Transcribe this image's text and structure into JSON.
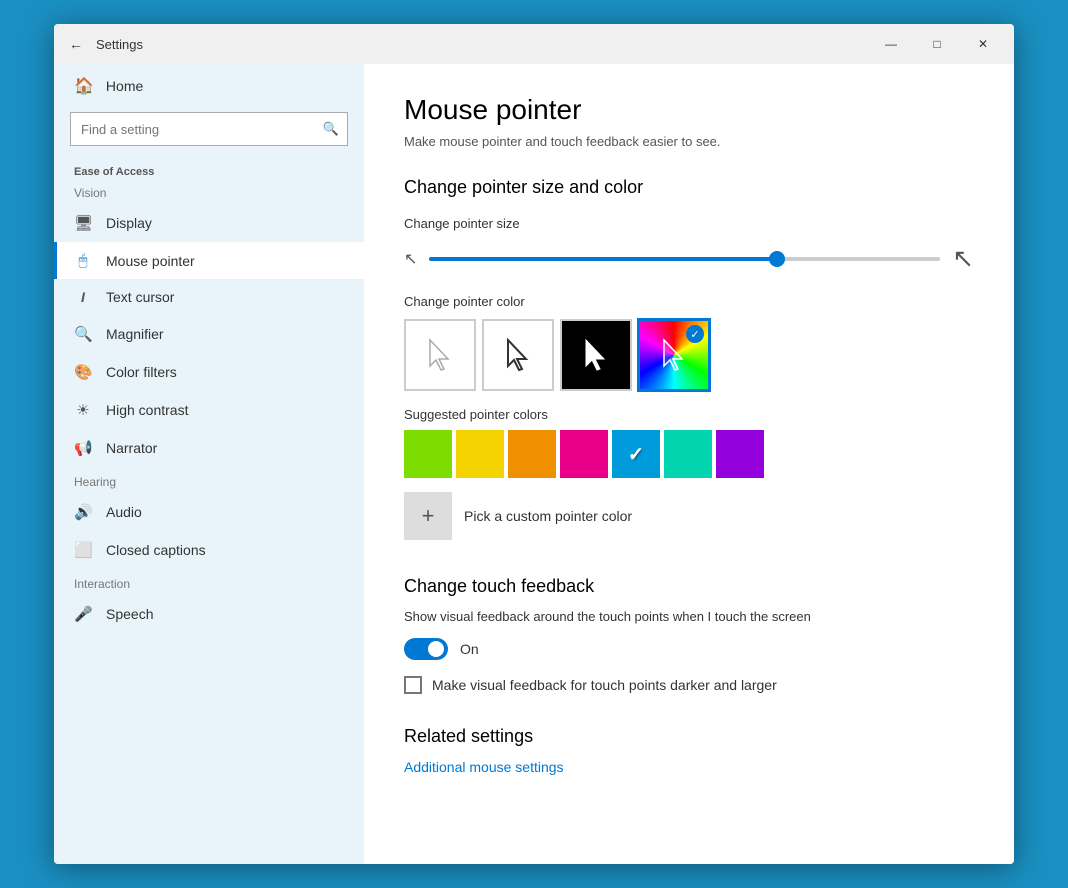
{
  "window": {
    "title": "Settings",
    "back_label": "←",
    "minimize_label": "—",
    "maximize_label": "□",
    "close_label": "✕"
  },
  "sidebar": {
    "home_label": "Home",
    "search_placeholder": "Find a setting",
    "section_vision": "Vision",
    "section_hearing": "Hearing",
    "section_interaction": "Interaction",
    "category_label": "Ease of Access",
    "nav_items_vision": [
      {
        "id": "display",
        "label": "Display",
        "icon": "🖥"
      },
      {
        "id": "mouse-pointer",
        "label": "Mouse pointer",
        "icon": "🖱",
        "active": true
      },
      {
        "id": "text-cursor",
        "label": "Text cursor",
        "icon": "I"
      },
      {
        "id": "magnifier",
        "label": "Magnifier",
        "icon": "🔍"
      },
      {
        "id": "color-filters",
        "label": "Color filters",
        "icon": "🎨"
      },
      {
        "id": "high-contrast",
        "label": "High contrast",
        "icon": "☀"
      },
      {
        "id": "narrator",
        "label": "Narrator",
        "icon": "📢"
      }
    ],
    "nav_items_hearing": [
      {
        "id": "audio",
        "label": "Audio",
        "icon": "🔊"
      },
      {
        "id": "closed-captions",
        "label": "Closed captions",
        "icon": "⬜"
      }
    ],
    "nav_items_interaction": [
      {
        "id": "speech",
        "label": "Speech",
        "icon": "🎤"
      }
    ]
  },
  "content": {
    "page_title": "Mouse pointer",
    "page_subtitle": "Make mouse pointer and touch feedback easier to see.",
    "change_pointer_size_color_heading": "Change pointer size and color",
    "change_pointer_size_label": "Change pointer size",
    "slider_percent": 68,
    "change_pointer_color_label": "Change pointer color",
    "pointer_color_options": [
      {
        "id": "white",
        "label": "White pointer",
        "bg": "#fff",
        "active": false
      },
      {
        "id": "black-outline",
        "label": "Black outline pointer",
        "bg": "#fff",
        "active": false
      },
      {
        "id": "black-fill",
        "label": "Black fill pointer",
        "bg": "#000",
        "active": false
      },
      {
        "id": "custom",
        "label": "Custom pointer",
        "bg": "custom",
        "active": true
      }
    ],
    "suggested_colors_label": "Suggested pointer colors",
    "suggested_colors": [
      {
        "id": "green",
        "hex": "#7edd00",
        "checked": false
      },
      {
        "id": "yellow",
        "hex": "#f5d300",
        "checked": false
      },
      {
        "id": "orange",
        "hex": "#f09000",
        "checked": false
      },
      {
        "id": "pink",
        "hex": "#e9008a",
        "checked": false
      },
      {
        "id": "blue",
        "hex": "#009bdb",
        "checked": true
      },
      {
        "id": "teal",
        "hex": "#00d5af",
        "checked": false
      },
      {
        "id": "purple",
        "hex": "#9400db",
        "checked": false
      }
    ],
    "custom_color_label": "Pick a custom pointer color",
    "touch_feedback_heading": "Change touch feedback",
    "touch_feedback_desc": "Show visual feedback around the touch points when I touch the screen",
    "toggle_state": "On",
    "checkbox_label": "Make visual feedback for touch points darker and larger",
    "related_settings_heading": "Related settings",
    "additional_mouse_settings_link": "Additional mouse settings"
  }
}
